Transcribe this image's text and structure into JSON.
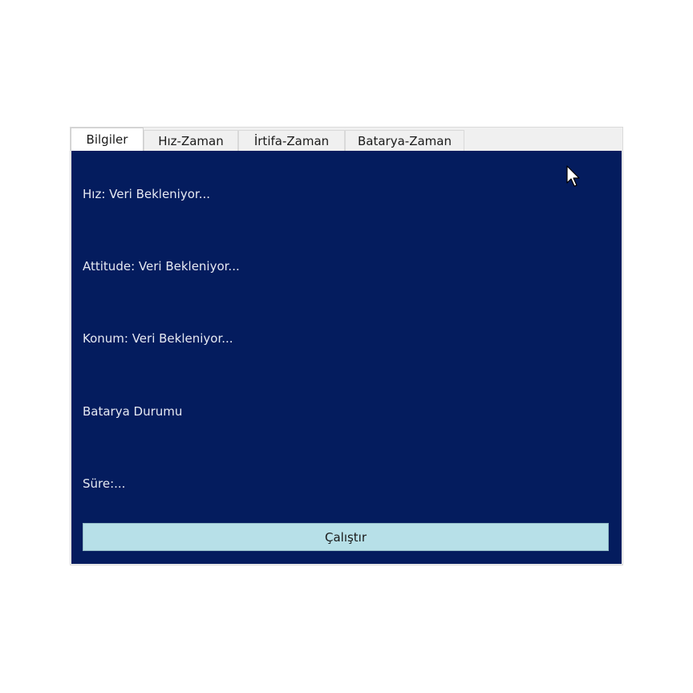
{
  "tabs": [
    {
      "label": "Bilgiler",
      "active": true
    },
    {
      "label": "Hız-Zaman",
      "active": false
    },
    {
      "label": "İrtifa-Zaman",
      "active": false
    },
    {
      "label": "Batarya-Zaman",
      "active": false
    }
  ],
  "fields": {
    "speed": "Hız: Veri Bekleniyor...",
    "attitude": "Attitude: Veri Bekleniyor...",
    "location": "Konum: Veri Bekleniyor...",
    "battery": "Batarya Durumu",
    "duration": "Süre:..."
  },
  "run_button_label": "Çalıştır",
  "colors": {
    "panel_background": "#041c5e",
    "button_background": "#b7e0e8",
    "label_text": "#e6e9f2"
  },
  "icons": {
    "cursor": "mouse-pointer-icon"
  }
}
